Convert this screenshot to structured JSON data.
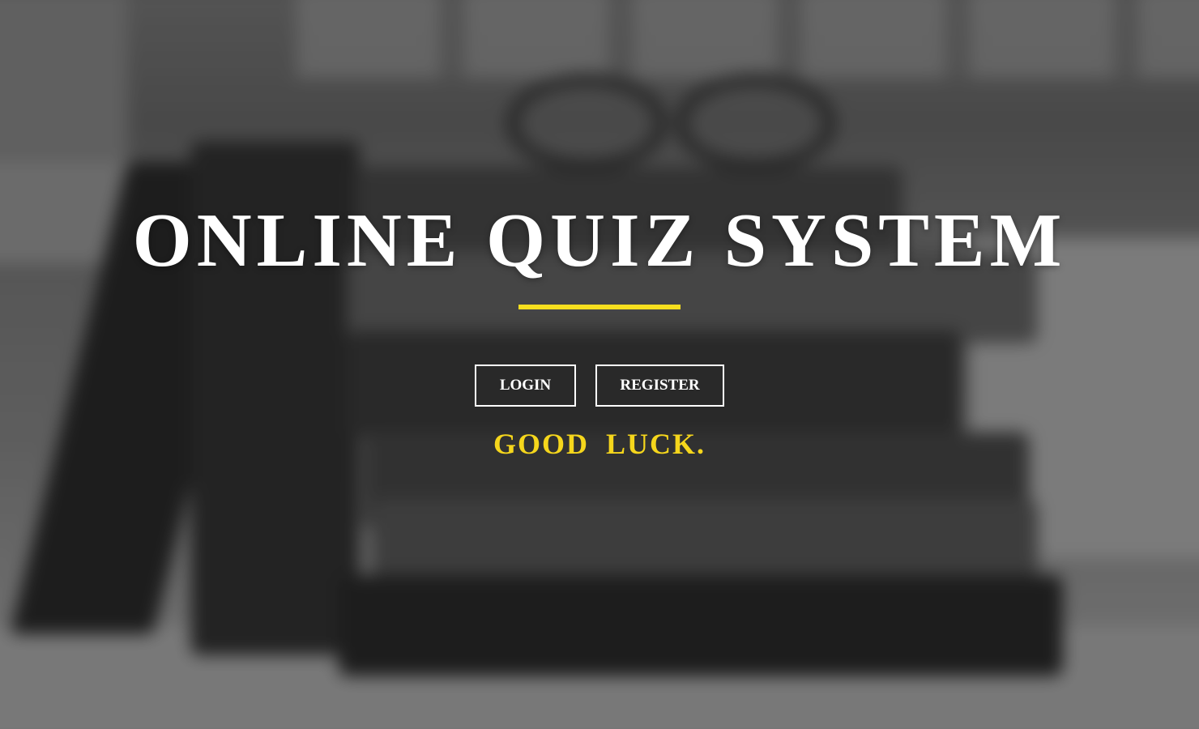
{
  "hero": {
    "title": "ONLINE QUIZ SYSTEM",
    "buttons": {
      "login_label": "LOGIN",
      "register_label": "REGISTER"
    },
    "tagline": "GOOD  LUCK."
  },
  "colors": {
    "accent": "#f7df1e",
    "tagline": "#f5d61c",
    "text": "#ffffff"
  },
  "background": {
    "description_icon": "books-and-glasses-photo"
  }
}
